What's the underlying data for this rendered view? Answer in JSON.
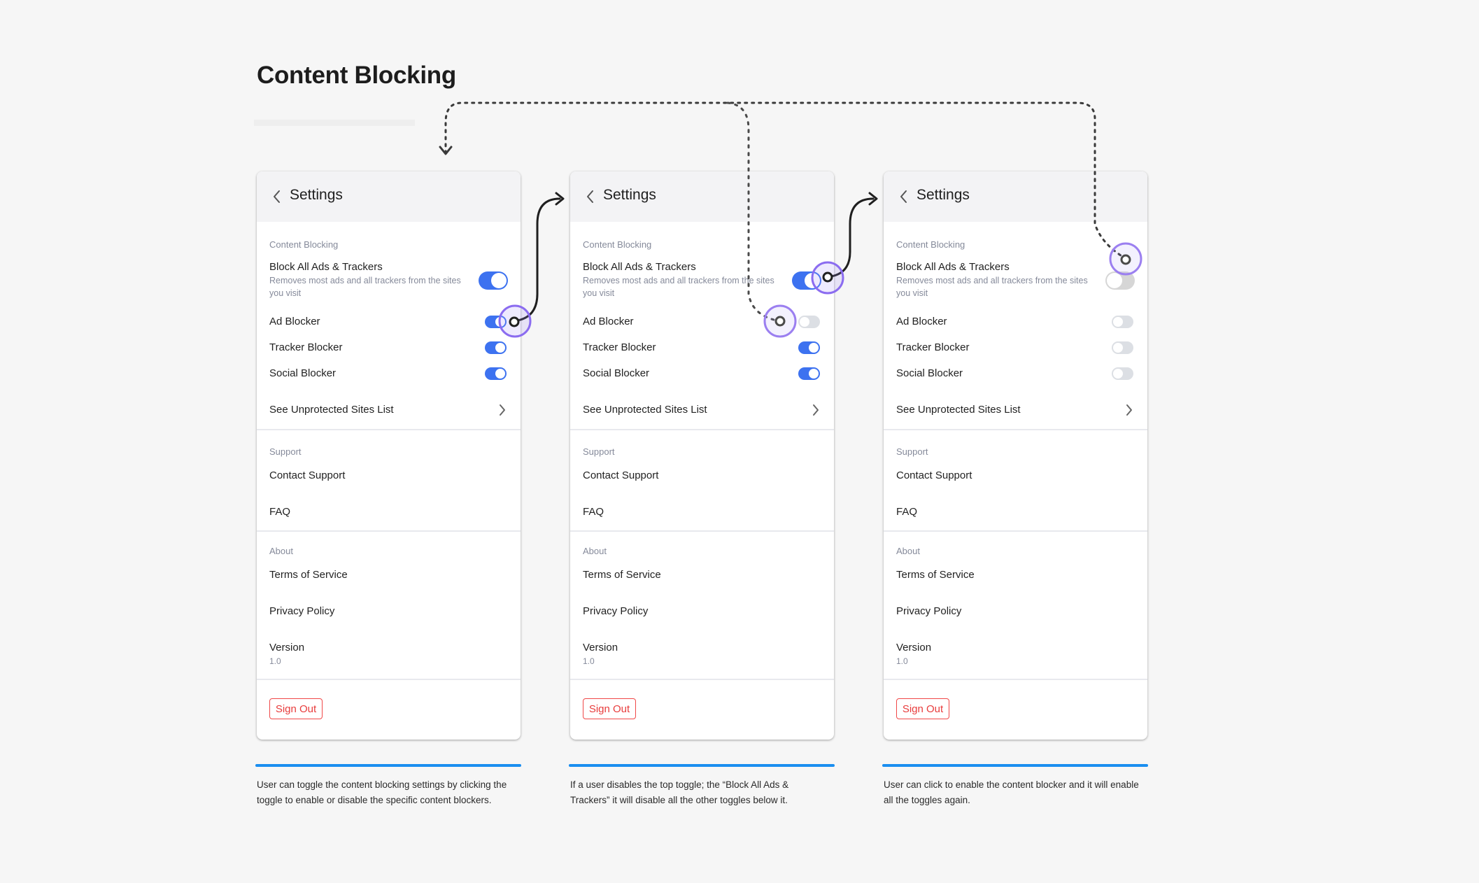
{
  "page": {
    "title": "Content Blocking"
  },
  "phones": [
    {
      "header_title": "Settings",
      "content_blocking_label": "Content Blocking",
      "block_all": {
        "label": "Block All Ads & Trackers",
        "description": "Removes most ads and all trackers from the sites you visit",
        "state": "on"
      },
      "toggles": [
        {
          "label": "Ad Blocker",
          "state": "on"
        },
        {
          "label": "Tracker Blocker",
          "state": "on"
        },
        {
          "label": "Social Blocker",
          "state": "on"
        }
      ],
      "unprotected_label": "See Unprotected Sites List",
      "support_label": "Support",
      "contact_support": "Contact Support",
      "faq": "FAQ",
      "about_label": "About",
      "terms": "Terms of Service",
      "privacy": "Privacy Policy",
      "version_label": "Version",
      "version_value": "1.0",
      "sign_out": "Sign Out",
      "caption": "User can toggle the content blocking settings by clicking the toggle to enable or disable the specific content blockers."
    },
    {
      "header_title": "Settings",
      "content_blocking_label": "Content Blocking",
      "block_all": {
        "label": "Block All Ads & Trackers",
        "description": "Removes most ads and all trackers from the sites you visit",
        "state": "on"
      },
      "toggles": [
        {
          "label": "Ad Blocker",
          "state": "off"
        },
        {
          "label": "Tracker Blocker",
          "state": "on"
        },
        {
          "label": "Social Blocker",
          "state": "on"
        }
      ],
      "unprotected_label": "See Unprotected Sites List",
      "support_label": "Support",
      "contact_support": "Contact Support",
      "faq": "FAQ",
      "about_label": "About",
      "terms": "Terms of Service",
      "privacy": "Privacy Policy",
      "version_label": "Version",
      "version_value": "1.0",
      "sign_out": "Sign Out",
      "caption": "If a user disables the top toggle; the “Block All Ads & Trackers” it will disable all the other toggles below it."
    },
    {
      "header_title": "Settings",
      "content_blocking_label": "Content Blocking",
      "block_all": {
        "label": "Block All Ads & Trackers",
        "description": "Removes most ads and all trackers from the sites you visit",
        "state": "off"
      },
      "toggles": [
        {
          "label": "Ad Blocker",
          "state": "off"
        },
        {
          "label": "Tracker Blocker",
          "state": "off"
        },
        {
          "label": "Social Blocker",
          "state": "off"
        }
      ],
      "unprotected_label": "See Unprotected Sites List",
      "support_label": "Support",
      "contact_support": "Contact Support",
      "faq": "FAQ",
      "about_label": "About",
      "terms": "Terms of Service",
      "privacy": "Privacy Policy",
      "version_label": "Version",
      "version_value": "1.0",
      "sign_out": "Sign Out",
      "caption": "User can click to enable the content blocker and it will enable all the toggles again."
    }
  ],
  "colors": {
    "toggle_on": "#3d72f0",
    "toggle_off": "#dcdfe4",
    "sign_out": "#e83c3c",
    "caption_bar": "#1a8ef0",
    "tap_indicator": "#8b6cf0"
  }
}
